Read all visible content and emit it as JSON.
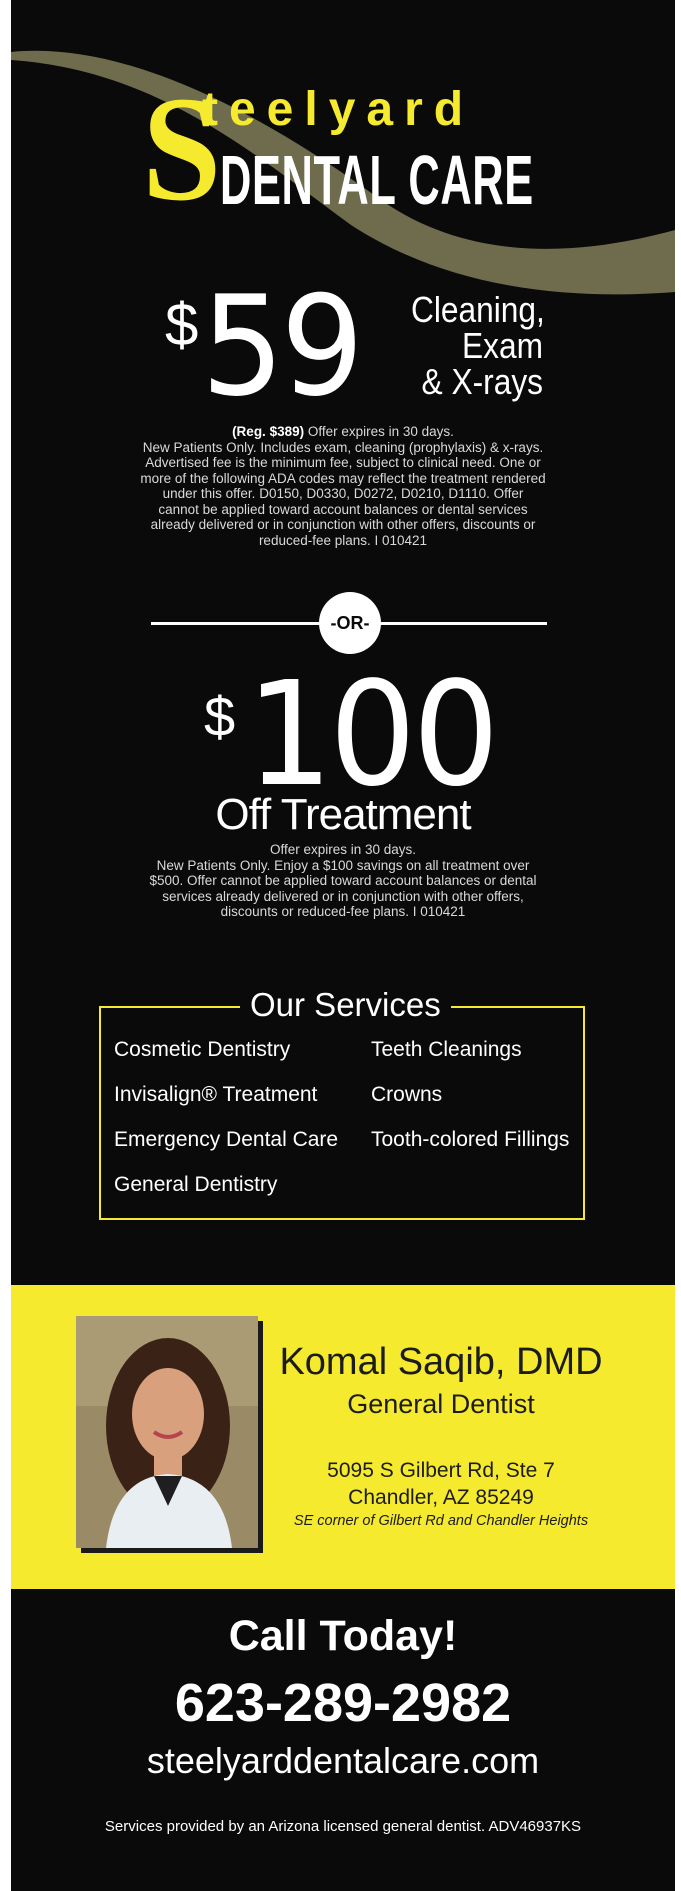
{
  "brand": {
    "logo_letter": "S",
    "logo_top": "teelyard",
    "logo_bottom": "DENTAL CARE"
  },
  "offer1": {
    "currency": "$",
    "amount": "59",
    "desc_line1": "Cleaning,",
    "desc_line2": "Exam",
    "desc_line3": "& X-rays",
    "reg": "(Reg. $389)",
    "expires": " Offer expires in 30 days.",
    "fine_lines": [
      "New Patients Only. Includes exam, cleaning (prophylaxis) & x-rays.",
      "Advertised fee is the minimum fee, subject to clinical need. One or",
      "more of the following ADA codes may reflect the treatment rendered",
      "under this offer. D0150, D0330, D0272, D0210, D1110. Offer",
      "cannot be applied toward account balances or dental services",
      "already delivered or in conjunction with other offers, discounts or",
      "reduced-fee plans.   I   010421"
    ]
  },
  "divider": {
    "label": "-OR-"
  },
  "offer2": {
    "currency": "$",
    "amount": "100",
    "title": "Off Treatment",
    "expires": "Offer expires in 30 days.",
    "fine_lines": [
      "New Patients Only. Enjoy a $100 savings on all treatment over",
      "$500. Offer cannot be applied toward account balances or dental",
      "services already delivered or in conjunction with other offers,",
      "discounts or reduced-fee plans.   I   010421"
    ]
  },
  "services": {
    "title": "Our Services",
    "left": [
      "Cosmetic Dentistry",
      "Invisalign® Treatment",
      "Emergency Dental Care",
      "General Dentistry"
    ],
    "right": [
      "Teeth Cleanings",
      "Crowns",
      "Tooth-colored Fillings"
    ]
  },
  "doctor": {
    "name": "Komal Saqib, DMD",
    "title": "General Dentist",
    "address_line1": "5095 S Gilbert Rd, Ste 7",
    "address_line2": "Chandler, AZ 85249",
    "cross_streets": "SE corner of Gilbert Rd and Chandler Heights"
  },
  "contact": {
    "call": "Call Today!",
    "phone": "623-289-2982",
    "website": "steelyarddentalcare.com",
    "disclaimer": "Services provided by an Arizona licensed general dentist. ADV46937KS"
  },
  "colors": {
    "background": "#0a0a0b",
    "accent_yellow": "#f5ea2e",
    "swoosh": "#6e6c4c",
    "text_white": "#ffffff"
  }
}
